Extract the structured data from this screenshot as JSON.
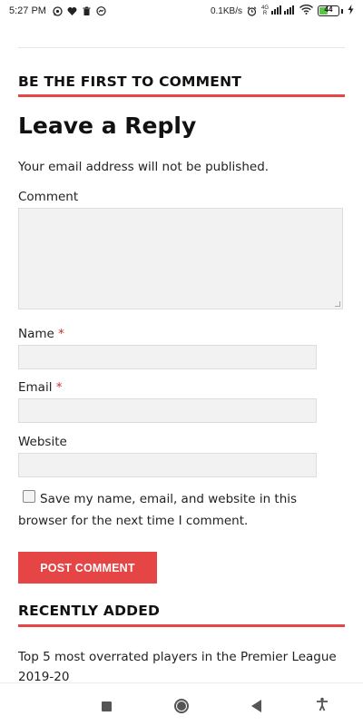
{
  "status_bar": {
    "time": "5:27 PM",
    "speed": "0.1KB/s",
    "network_label_top": "4G",
    "network_label_bottom": "R",
    "battery": "44",
    "battery_level": 0.44
  },
  "comments": {
    "heading": "BE THE FIRST TO COMMENT"
  },
  "reply": {
    "title": "Leave a Reply",
    "notice": "Your email address will not be published.",
    "comment_label": "Comment",
    "name_label": "Name",
    "email_label": "Email",
    "required_mark": "*",
    "website_label": "Website",
    "consent_text": "Save my name, email, and website in this browser for the next time I comment.",
    "submit_label": "POST COMMENT"
  },
  "recent": {
    "heading": "RECENTLY ADDED",
    "items": [
      {
        "title": "Top 5 most overrated players in the Premier League 2019-20"
      }
    ]
  },
  "colors": {
    "accent": "#e64545",
    "field_bg": "#f2f2f2",
    "required": "#d12c2c"
  },
  "icons": [
    "whatsapp-icon",
    "heart-icon",
    "trash-icon",
    "messenger-icon",
    "alarm-icon",
    "signal-icon",
    "wifi-icon",
    "battery-icon",
    "charging-icon",
    "recents-icon",
    "home-icon",
    "back-icon",
    "accessibility-icon"
  ]
}
